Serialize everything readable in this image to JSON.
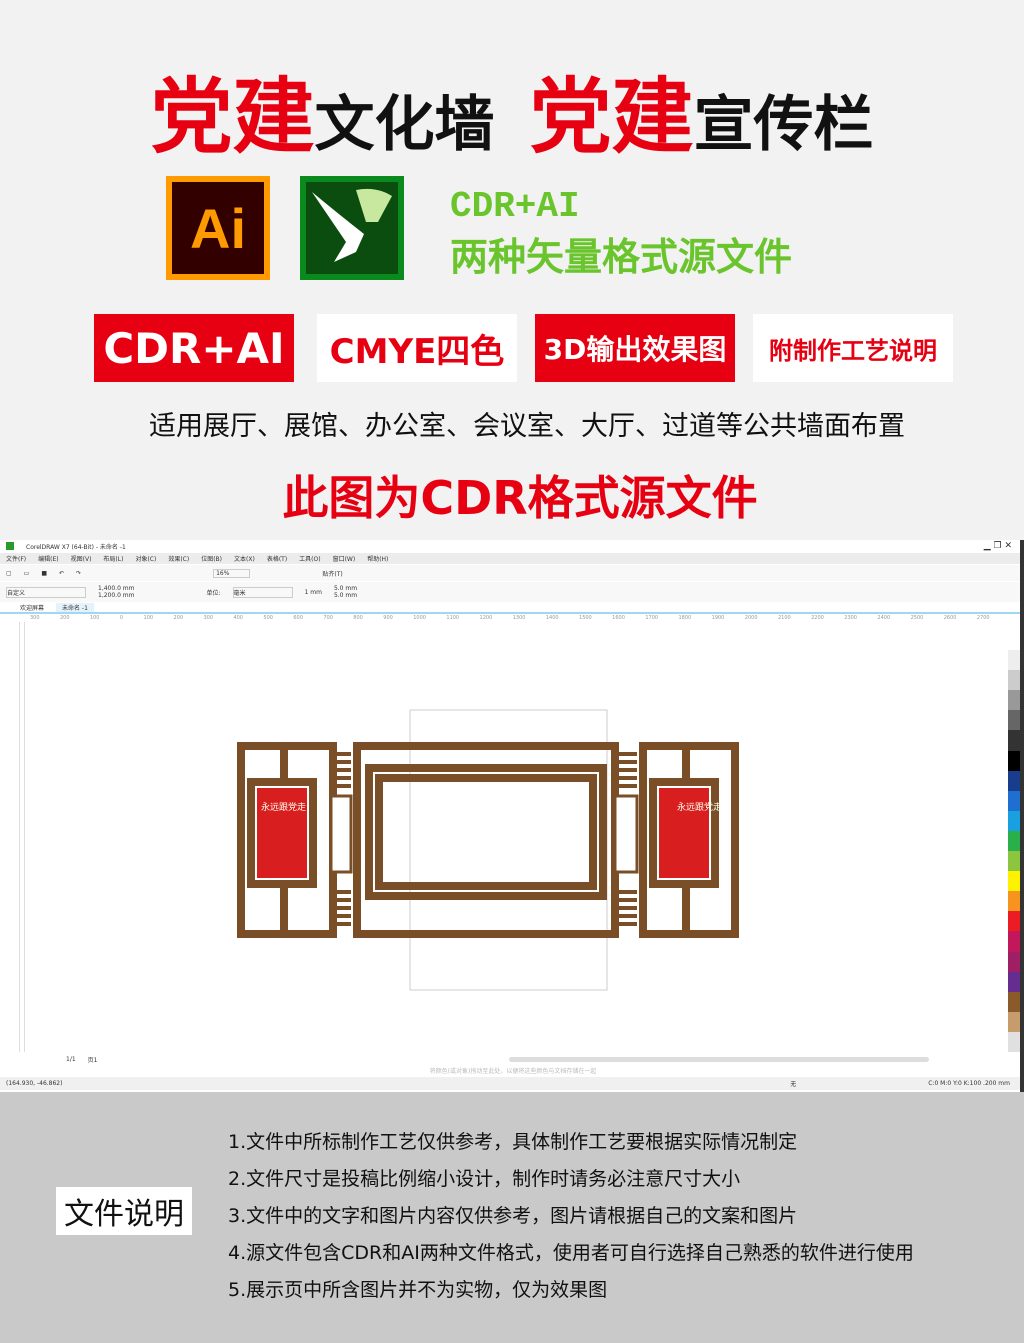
{
  "title": {
    "part1": "党建",
    "part2": "文化墙",
    "part3": "党建",
    "part4": "宣传栏"
  },
  "logos": {
    "ai_text": "Ai",
    "ai_icon": "adobe-illustrator-icon",
    "cdr_icon": "coreldraw-icon"
  },
  "formats": {
    "line1": "CDR+AI",
    "line2": "两种矢量格式源文件"
  },
  "badges": [
    "CDR+AI",
    "CMYE四色",
    "3D输出效果图",
    "附制作工艺说明"
  ],
  "usage": "适用展厅、展馆、办公室、会议室、大厅、过道等公共墙面布置",
  "note": "此图为CDR格式源文件",
  "app": {
    "window_title": "CorelDRAW X7 (64-Bit) - 未命名 -1",
    "menu": [
      "文件(F)",
      "编辑(E)",
      "视图(V)",
      "布局(L)",
      "对象(C)",
      "效果(C)",
      "位图(B)",
      "文本(X)",
      "表格(T)",
      "工具(O)",
      "窗口(W)",
      "帮助(H)"
    ],
    "zoom": "16%",
    "snap": "贴齐(T)",
    "page_preset": "自定义",
    "width": "1,400.0 mm",
    "height": "1,200.0 mm",
    "units_label": "单位:",
    "units": "毫米",
    "nudge": "1 mm",
    "dup_x": "5.0 mm",
    "dup_y": "5.0 mm",
    "tabs": [
      "欢迎屏幕",
      "未命名 -1"
    ],
    "ruler": [
      "300",
      "200",
      "100",
      "0",
      "100",
      "200",
      "300",
      "400",
      "500",
      "600",
      "700",
      "800",
      "900",
      "1000",
      "1100",
      "1200",
      "1300",
      "1400",
      "1500",
      "1600",
      "1700",
      "1800",
      "1900",
      "2000",
      "2100",
      "2200",
      "2300",
      "2400",
      "2500",
      "2600",
      "2700"
    ],
    "page_nav": "1/1",
    "page_tab": "页1",
    "hint": "将颜色(或对象)拖动至此处，以便将这些颜色与文档存储在一起",
    "coords": "(164.930, -46.862)",
    "fill": "无",
    "outline": "C:0 M:0 Y:0 K:100  .200 mm",
    "poster_text": "永远跟党走",
    "brown": "#7a4f28"
  },
  "footer": {
    "label": "文件说明",
    "items": [
      "1.文件中所标制作工艺仅供参考，具体制作工艺要根据实际情况制定",
      "2.文件尺寸是投稿比例缩小设计，制作时请务必注意尺寸大小",
      "3.文件中的文字和图片内容仅供参考，图片请根据自己的文案和图片",
      "4.源文件包含CDR和AI两种文件格式，使用者可自行选择自己熟悉的软件进行使用",
      "5.展示页中所含图片并不为实物，仅为效果图"
    ]
  }
}
